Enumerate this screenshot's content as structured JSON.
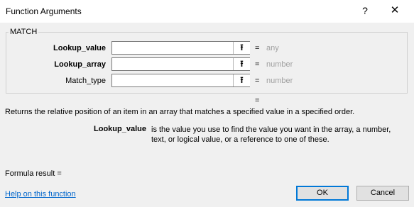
{
  "window": {
    "title": "Function Arguments",
    "help_glyph": "?",
    "close_glyph": "✕"
  },
  "function": {
    "name": "MATCH",
    "args": [
      {
        "label": "Lookup_value",
        "value": "",
        "equals": "=",
        "type_hint": "any",
        "bold": true
      },
      {
        "label": "Lookup_array",
        "value": "",
        "equals": "=",
        "type_hint": "number",
        "bold": true
      },
      {
        "label": "Match_type",
        "value": "",
        "equals": "=",
        "type_hint": "number",
        "bold": false
      }
    ],
    "collapse_glyph": "⭱",
    "result_equals": "=",
    "description": "Returns the relative position of an item in an array that matches a specified value in a specified order.",
    "arg_desc_name": "Lookup_value",
    "arg_desc_text": "is the value you use to find the value you want in the array, a number, text, or logical value, or a reference to one of these."
  },
  "footer": {
    "formula_result": "Formula result =",
    "help_link": "Help on this function",
    "ok_label": "OK",
    "cancel_label": "Cancel"
  }
}
